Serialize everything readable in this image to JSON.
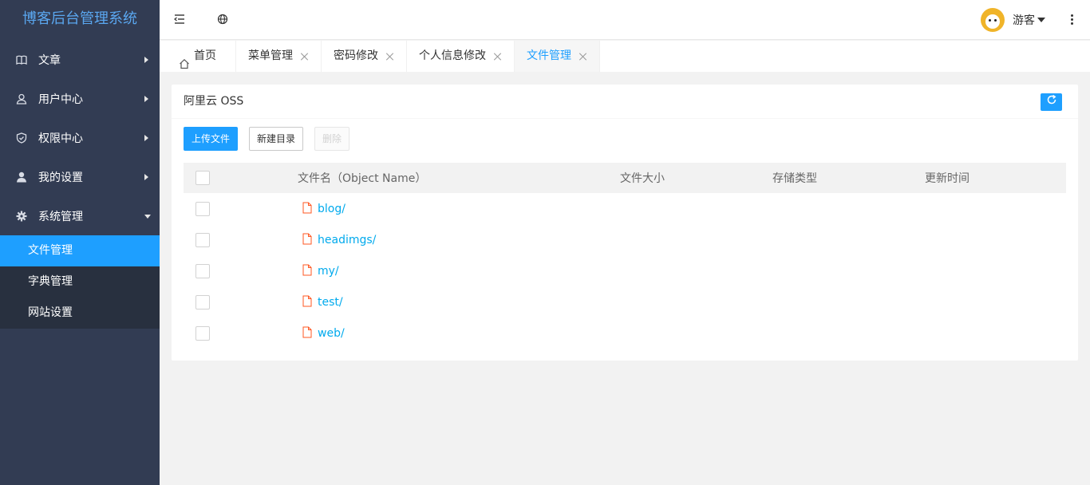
{
  "app": {
    "title": "博客后台管理系统"
  },
  "sidebar": {
    "items": [
      {
        "label": "文章",
        "icon": "book-icon"
      },
      {
        "label": "用户中心",
        "icon": "user-outline-icon"
      },
      {
        "label": "权限中心",
        "icon": "shield-icon"
      },
      {
        "label": "我的设置",
        "icon": "user-icon"
      },
      {
        "label": "系统管理",
        "icon": "gear-icon",
        "expanded": true
      }
    ],
    "subitems": [
      {
        "label": "文件管理",
        "active": true
      },
      {
        "label": "字典管理"
      },
      {
        "label": "网站设置"
      }
    ]
  },
  "header": {
    "user_name": "游客"
  },
  "tabs": [
    {
      "label": "首页"
    },
    {
      "label": "菜单管理"
    },
    {
      "label": "密码修改"
    },
    {
      "label": "个人信息修改"
    },
    {
      "label": "文件管理",
      "active": true
    }
  ],
  "card": {
    "title": "阿里云 OSS",
    "buttons": {
      "upload": "上传文件",
      "new_dir": "新建目录",
      "delete": "删除"
    },
    "columns": [
      "文件名（Object Name）",
      "文件大小",
      "存储类型",
      "更新时间"
    ],
    "rows": [
      {
        "name": "blog/"
      },
      {
        "name": "headimgs/"
      },
      {
        "name": "my/"
      },
      {
        "name": "test/"
      },
      {
        "name": "web/"
      }
    ]
  },
  "colors": {
    "accent": "#1e9fff",
    "sidebar": "#323c53",
    "link": "#01aaed",
    "file_icon": "#ff5722"
  }
}
